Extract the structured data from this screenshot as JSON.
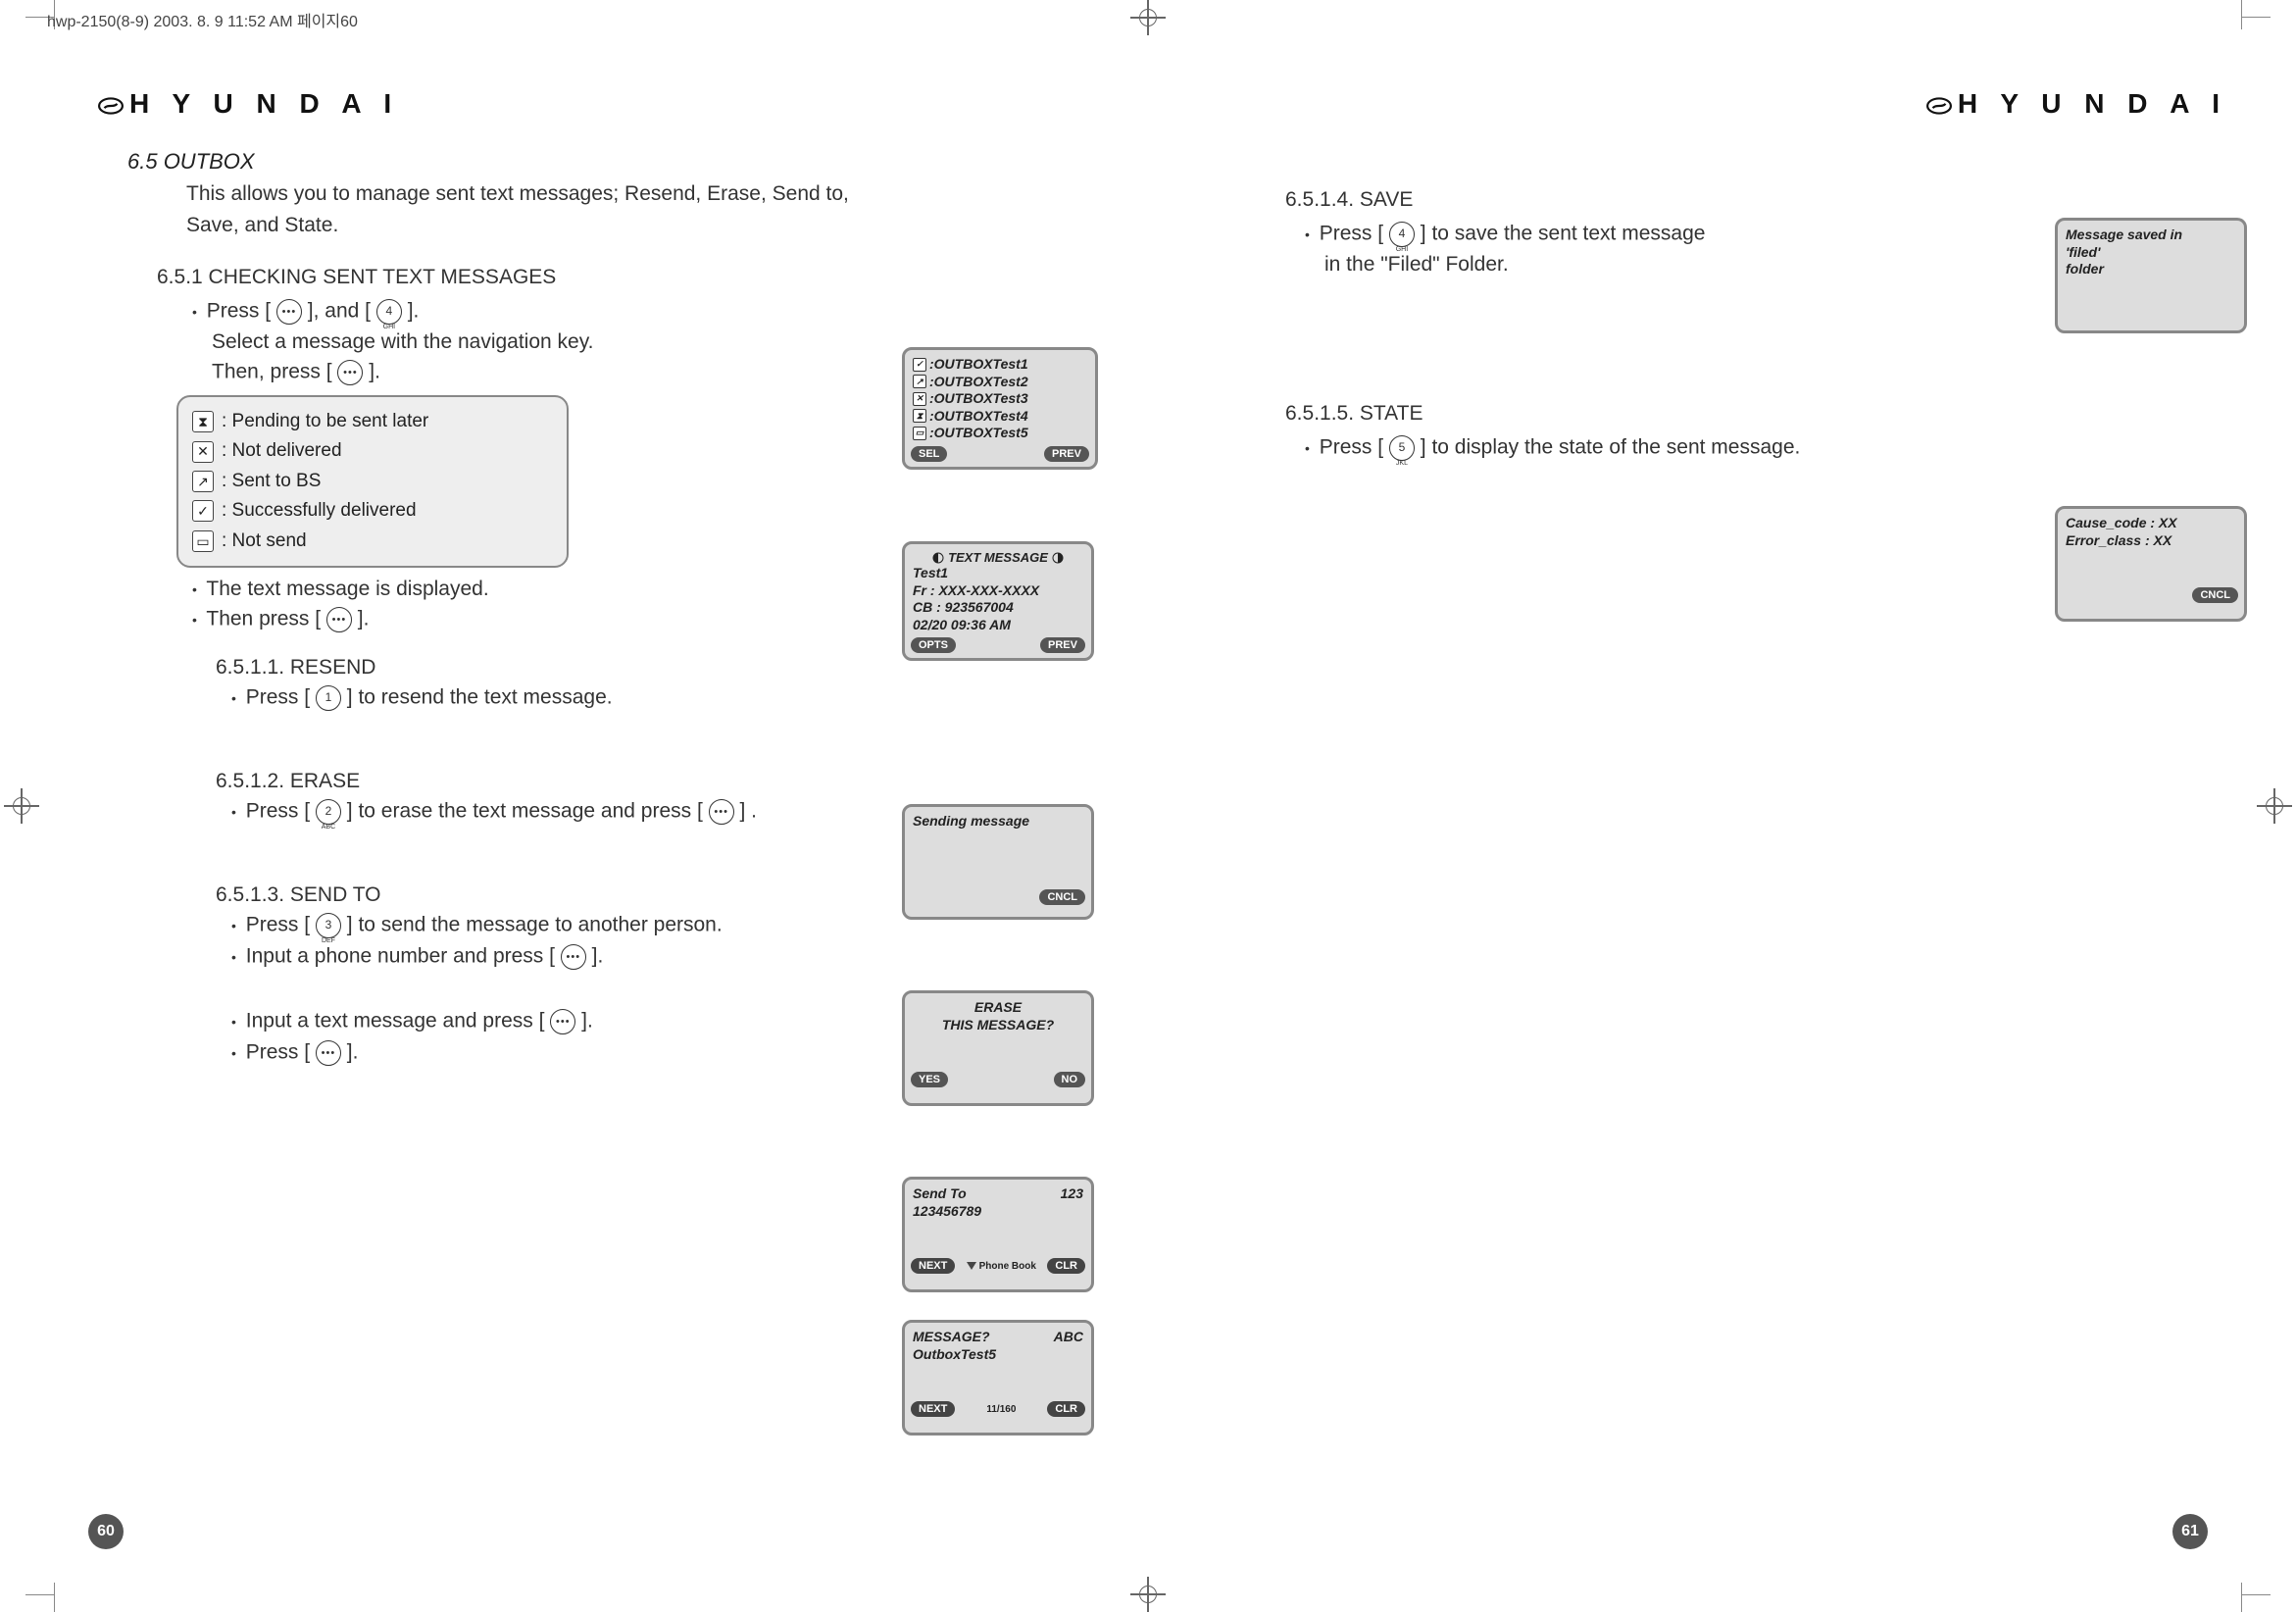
{
  "meta": {
    "header": "hwp-2150(8-9)  2003. 8. 9 11:52 AM 페이지60"
  },
  "brand": "H Y U N D A I",
  "page_numbers": {
    "left": "60",
    "right": "61"
  },
  "left": {
    "section_title": "6.5 OUTBOX",
    "section_desc": "This allows you to manage sent text messages; Resend, Erase, Send to, Save, and State.",
    "sub651": "6.5.1 CHECKING SENT TEXT MESSAGES",
    "step_press": "Press [",
    "step_press_and": "], and [",
    "step_press_end": "].",
    "step_select": "Select a message with the navigation key.",
    "step_then": "Then, press [",
    "step_then_end": "].",
    "legend": {
      "pending": ": Pending to be sent later",
      "notdeliv": ": Not delivered",
      "sentbs": ": Sent to BS",
      "success": ": Successfully delivered",
      "notsend": ": Not send"
    },
    "step_disp": "The text message is displayed.",
    "step_then2": "Then press [",
    "step_then2_end": "].",
    "s6511": "6.5.1.1. RESEND",
    "s6511_step": "] to resend the text message.",
    "s6512": "6.5.1.2. ERASE",
    "s6512_step_a": "] to erase the text message and press [",
    "s6512_step_b": "] .",
    "s6513": "6.5.1.3. SEND TO",
    "s6513_step1": "] to send the message to another person.",
    "s6513_step2a": "Input a phone number and press [",
    "s6513_step2b": "].",
    "s6513_step3a": "Input a text message and press [",
    "s6513_step3b": "].",
    "s6513_step4a": "Press [",
    "s6513_step4b": "].",
    "screens": {
      "list": {
        "l1": ":OUTBOXTest1",
        "l2": ":OUTBOXTest2",
        "l3": ":OUTBOXTest3",
        "l4": ":OUTBOXTest4",
        "l5": ":OUTBOXTest5",
        "sk_l": "SEL",
        "sk_r": "PREV"
      },
      "detail": {
        "title": "TEXT MESSAGE",
        "l1": "Test1",
        "l2": "Fr : XXX-XXX-XXXX",
        "l3": "CB : 923567004",
        "l4": "02/20 09:36 AM",
        "sk_l": "OPTS",
        "sk_r": "PREV"
      },
      "sending": {
        "l1": "Sending message",
        "sk_r": "CNCL"
      },
      "erase": {
        "l1": "ERASE",
        "l2": "THIS MESSAGE?",
        "sk_l": "YES",
        "sk_r": "NO"
      },
      "sendto": {
        "l1": "Send To",
        "mode": "123",
        "l2": "123456789",
        "sk_l": "NEXT",
        "mid": "Phone Book",
        "sk_r": "CLR"
      },
      "msg": {
        "l1": "MESSAGE?",
        "mode": "ABC",
        "l2": "OutboxTest5",
        "sk_l": "NEXT",
        "mid": "11/160",
        "sk_r": "CLR"
      }
    }
  },
  "right": {
    "s6514": "6.5.1.4. SAVE",
    "s6514_step_a": "] to save the sent text message",
    "s6514_step_b": "in the \"Filed\" Folder.",
    "screen_save": {
      "l1": "Message saved in",
      "l2": "'filed'",
      "l3": "folder"
    },
    "s6515": "6.5.1.5. STATE",
    "s6515_step": "] to display the state of the sent message.",
    "screen_state": {
      "l1": "Cause_code : XX",
      "l2": "Error_class : XX",
      "sk_r": "CNCL"
    }
  },
  "keys": {
    "k1": "1",
    "k2": "2",
    "k2s": "ABC",
    "k3": "3",
    "k3s": "DEF",
    "k4": "4",
    "k4s": "GHI",
    "k5": "5",
    "k5s": "JKL"
  }
}
